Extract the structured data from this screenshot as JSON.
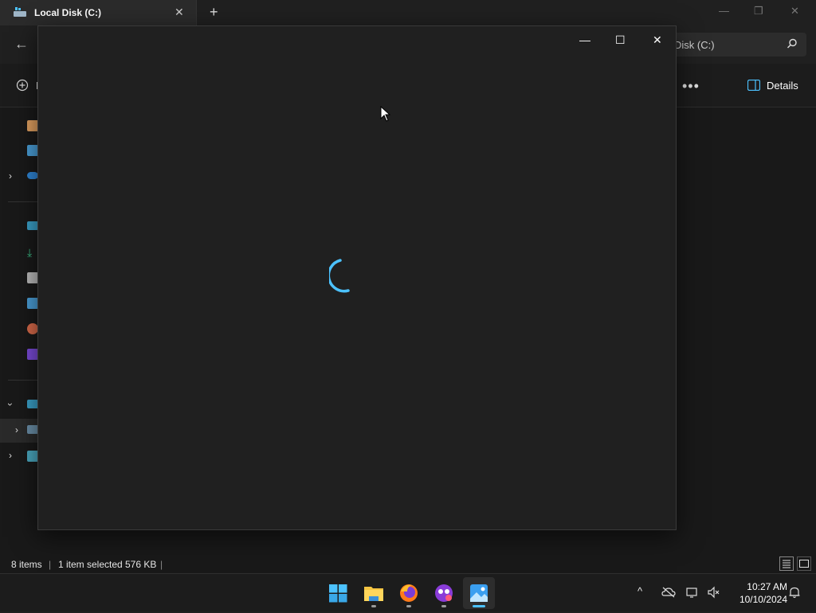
{
  "explorer": {
    "tab_title": "Local Disk (C:)",
    "search_text": "Disk (C:)",
    "new_button_label": "N",
    "details_label": "Details",
    "more_label": "•••"
  },
  "statusbar": {
    "item_count": "8 items",
    "selection": "1 item selected",
    "size": "576 KB"
  },
  "photos_window": {
    "minimize": "—",
    "maximize": "☐",
    "close": "✕",
    "spinner_color": "#4cc2ff"
  },
  "taskbar": {
    "time": "10:27 AM",
    "date": "10/10/2024",
    "apps": [
      "start",
      "file-explorer",
      "firefox",
      "app-purple",
      "photos"
    ]
  },
  "colors": {
    "accent": "#4cc2ff",
    "background": "#191919"
  }
}
